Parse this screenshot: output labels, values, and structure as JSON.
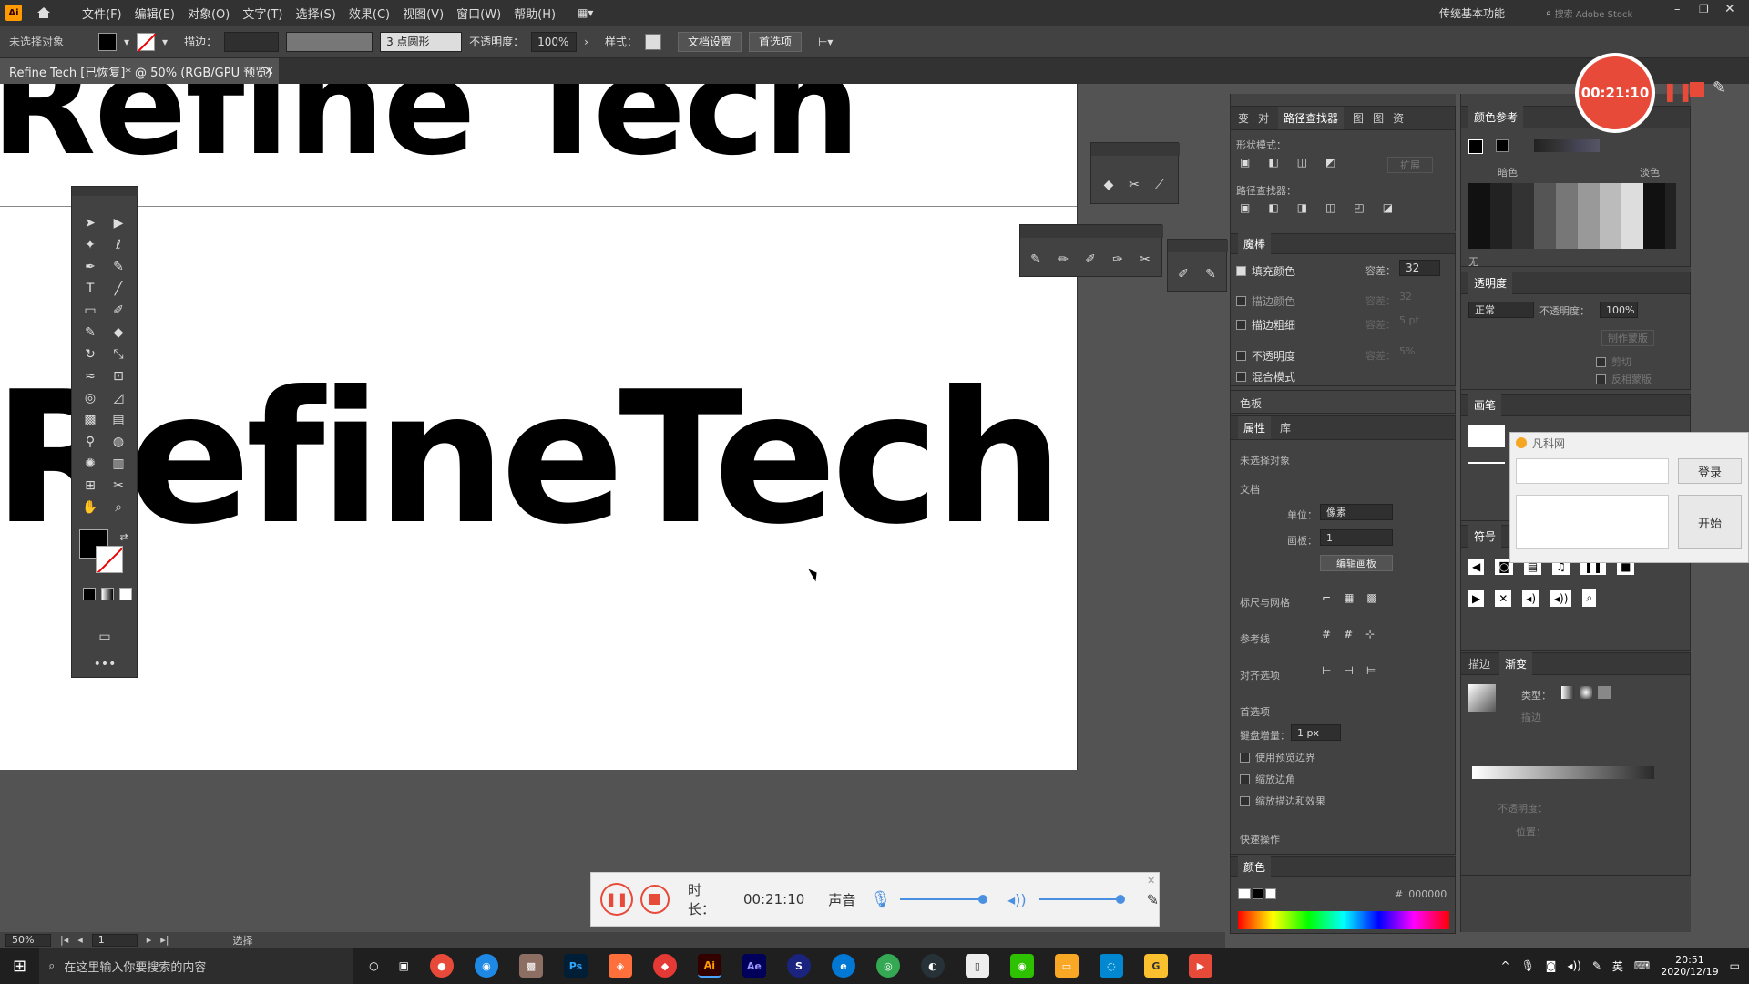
{
  "app": {
    "logo": "Ai"
  },
  "menu": [
    "文件(F)",
    "编辑(E)",
    "对象(O)",
    "文字(T)",
    "选择(S)",
    "效果(C)",
    "视图(V)",
    "窗口(W)",
    "帮助(H)"
  ],
  "workspace": "传统基本功能",
  "search_placeholder": "搜索 Adobe Stock",
  "control": {
    "selection": "未选择对象",
    "stroke_label": "描边：",
    "brush": "3 点圆形",
    "opacity_label": "不透明度：",
    "opacity": "100%",
    "style_label": "样式：",
    "doc_setup": "文档设置",
    "prefs": "首选项"
  },
  "document_tab": "Refine Tech [已恢复]* @ 50% (RGB/GPU 预览)",
  "canvas": {
    "headline_top": "Refine Tech",
    "headline_main": "RefineTech"
  },
  "pathfinder": {
    "tabs": [
      "变",
      "对",
      "路径查找器",
      "图",
      "图",
      "资"
    ],
    "shape_modes": "形状模式：",
    "expand": "扩展",
    "pathfinders": "路径查找器："
  },
  "magic_wand": {
    "title": "魔棒",
    "rows": [
      {
        "label": "填充颜色",
        "checked": true,
        "tol_label": "容差：",
        "tol": "32"
      },
      {
        "label": "描边颜色",
        "checked": false,
        "tol_label": "容差：",
        "tol": "32"
      },
      {
        "label": "描边粗细",
        "checked": false,
        "tol_label": "容差：",
        "tol": "5 pt"
      },
      {
        "label": "不透明度",
        "checked": false,
        "tol_label": "容差：",
        "tol": "5%"
      },
      {
        "label": "混合模式",
        "checked": false
      }
    ]
  },
  "swatches_header": "色板",
  "properties": {
    "tabs": [
      "属性",
      "库"
    ],
    "no_selection": "未选择对象",
    "document": "文档",
    "units_label": "单位：",
    "units": "像素",
    "artboard_label": "画板：",
    "artboard": "1",
    "edit_artboards": "编辑画板",
    "rulers_grids": "标尺与网格",
    "guides": "参考线",
    "snap": "对齐选项",
    "preferences": "首选项",
    "key_inc_label": "键盘增量：",
    "key_inc": "1 px",
    "opts": [
      "使用预览边界",
      "缩放边角",
      "缩放描边和效果"
    ],
    "quick_actions": "快速操作"
  },
  "color_panel": {
    "title": "颜色",
    "hex_label": "#",
    "hex": "000000"
  },
  "color_guide": {
    "title": "颜色参考",
    "dark": "暗色",
    "light": "淡色",
    "none": "无"
  },
  "transparency": {
    "title": "透明度",
    "mode": "正常",
    "opacity_label": "不透明度：",
    "opacity": "100%",
    "make_mask": "制作蒙版",
    "clip": "剪切",
    "invert": "反相蒙版"
  },
  "brushes": {
    "title": "画笔"
  },
  "symbols": {
    "title": "符号"
  },
  "stroke_gradient": {
    "stroke": "描边",
    "gradient": "渐变",
    "type_label": "类型：",
    "stroke_label": "描边",
    "opacity_label": "不透明度：",
    "position_label": "位置："
  },
  "login_popup": {
    "title": "凡科网",
    "login": "登录",
    "start": "开始"
  },
  "recorder": {
    "label": "时长：",
    "time": "00:21:10",
    "sound": "声音"
  },
  "rec_timer": "00:21:10",
  "statusbar": {
    "zoom": "50%",
    "page": "1",
    "tool": "选择"
  },
  "taskbar": {
    "search": "在这里输入你要搜索的内容",
    "time": "20:51",
    "date": "2020/12/19",
    "lang": "英"
  }
}
